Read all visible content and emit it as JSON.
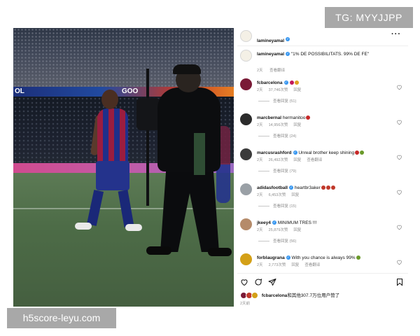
{
  "watermarks": {
    "top_right": "TG: MYYJJPP",
    "bottom_left": "h5score-leyu.com"
  },
  "photo": {
    "led_text_left": "OL",
    "led_text_right": "GOO"
  },
  "post": {
    "author": "lamineyamal",
    "more_icon": "ellipsis-icon",
    "caption": {
      "user": "lamineyamal",
      "text": "\"1% DE POSSIBILITATS. 99% DE FE\"",
      "time": "2天",
      "see_translation": "查看翻译"
    }
  },
  "comments": [
    {
      "user": "fcbarcelona",
      "verified": true,
      "text": "",
      "emoji_colors": [
        "#c2185b",
        "#e0a020"
      ],
      "time": "2天",
      "likes": "37,746次赞",
      "reply": "回复",
      "view_replies": "查看回复 (51)",
      "avatar_color": "#7a1a36"
    },
    {
      "user": "marcbernal",
      "verified": false,
      "text": "hermanitoo",
      "emoji_colors": [
        "#c62828"
      ],
      "time": "2天",
      "likes": "14,956次赞",
      "reply": "回复",
      "view_replies": "查看回复 (24)",
      "avatar_color": "#2b2b2b"
    },
    {
      "user": "marcusrashford",
      "verified": true,
      "text": "Unreal brother keep shining",
      "emoji_colors": [
        "#c62828",
        "#6a9a2a"
      ],
      "time": "2天",
      "likes": "26,492次赞",
      "reply": "回复",
      "see_translation": "查看翻译",
      "view_replies": "查看回复 (79)",
      "avatar_color": "#3b3b3b"
    },
    {
      "user": "adidasfootball",
      "verified": true,
      "text": "heartbr3aker",
      "emoji_colors": [
        "#c0392b",
        "#c0392b",
        "#c0392b"
      ],
      "time": "2天",
      "likes": "6,453次赞",
      "reply": "回复",
      "view_replies": "查看回复 (15)",
      "avatar_color": "#9aa0a6"
    },
    {
      "user": "jkeey4",
      "verified": true,
      "text": "MINIMUM TRES !!!",
      "emoji_colors": [],
      "time": "2天",
      "likes": "25,879次赞",
      "reply": "回复",
      "view_replies": "查看回复 (56)",
      "avatar_color": "#b58b6a"
    },
    {
      "user": "forblaugrana",
      "verified": true,
      "text": "With you chance is always 99%",
      "emoji_colors": [
        "#6a9a2a"
      ],
      "time": "2天",
      "likes": "2,773次赞",
      "reply": "回复",
      "see_translation": "查看翻译",
      "view_replies": "",
      "avatar_color": "#d4a017"
    }
  ],
  "actions": {
    "like_icon": "heart-icon",
    "comment_icon": "comment-icon",
    "share_icon": "share-icon",
    "save_icon": "bookmark-icon"
  },
  "likes_summary": {
    "prefix_user": "fcbarcelona",
    "text": "和其他307.7万位用户赞了",
    "time": "2天前"
  }
}
